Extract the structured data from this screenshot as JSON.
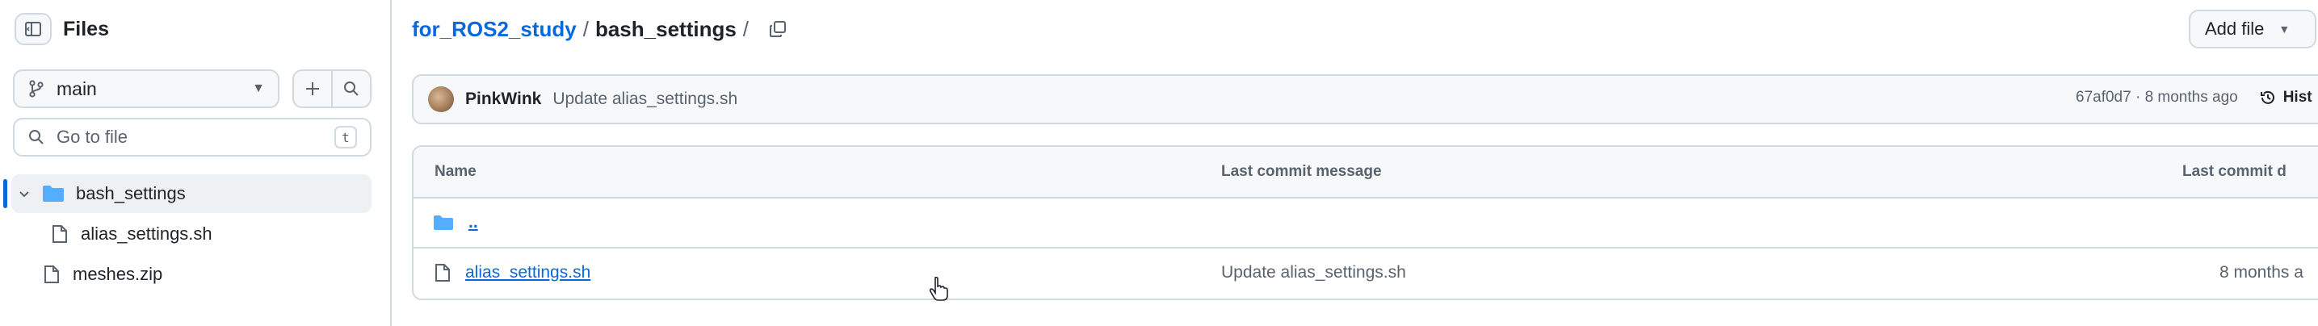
{
  "sidebar": {
    "title": "Files",
    "branch": "main",
    "goto_placeholder": "Go to file",
    "goto_shortcut": "t",
    "tree": [
      {
        "label": "bash_settings",
        "type": "folder",
        "expanded": true,
        "active": true
      },
      {
        "label": "alias_settings.sh",
        "type": "file"
      },
      {
        "label": "meshes.zip",
        "type": "file"
      }
    ]
  },
  "breadcrumb": {
    "repo": "for_ROS2_study",
    "separator": "/",
    "current": "bash_settings",
    "trailing": "/"
  },
  "toolbar": {
    "add_file_label": "Add file"
  },
  "commit": {
    "author": "PinkWink",
    "message": "Update alias_settings.sh",
    "meta": "67af0d7 · 8 months ago",
    "history_label": "Hist"
  },
  "table": {
    "headers": {
      "name": "Name",
      "message": "Last commit message",
      "date": "Last commit d"
    },
    "rows": [
      {
        "name": "..",
        "type": "folder",
        "message": "",
        "date": ""
      },
      {
        "name": "alias_settings.sh",
        "type": "file",
        "message": "Update alias_settings.sh",
        "date": "8 months a"
      }
    ]
  },
  "colors": {
    "link": "#0969da",
    "border": "#d1d9e0",
    "muted": "#59636e",
    "folder": "#54aeff"
  }
}
